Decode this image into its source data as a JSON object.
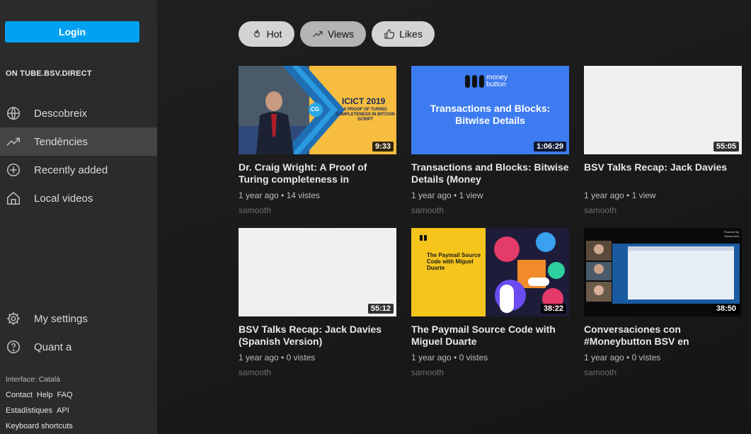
{
  "sidebar": {
    "login_label": "Login",
    "section_title": "ON TUBE.BSV.DIRECT",
    "nav": [
      {
        "label": "Descobreix",
        "icon": "globe-icon"
      },
      {
        "label": "Tendències",
        "icon": "trending-icon"
      },
      {
        "label": "Recently added",
        "icon": "plus-circle-icon"
      },
      {
        "label": "Local videos",
        "icon": "home-icon"
      }
    ],
    "bottom_nav": [
      {
        "label": "My settings",
        "icon": "gear-icon"
      },
      {
        "label": "Quant a",
        "icon": "help-icon"
      }
    ],
    "interface": "Interface: Català",
    "links_row1": [
      "Contact",
      "Help",
      "FAQ"
    ],
    "links_row2": [
      "Estadístiques",
      "API"
    ],
    "links_row3": [
      "Keyboard shortcuts"
    ]
  },
  "filters": [
    {
      "label": "Hot",
      "icon": "flame-icon",
      "active": false
    },
    {
      "label": "Views",
      "icon": "trending-icon",
      "active": true
    },
    {
      "label": "Likes",
      "icon": "thumbs-up-icon",
      "active": false
    }
  ],
  "videos": [
    {
      "title": "Dr. Craig Wright: A Proof of Turing completeness in",
      "duration": "9:33",
      "meta": "1 year ago • 14 vistes",
      "channel": "samooth",
      "thumb_text": [
        "ICICT 2019",
        "A PROOF OF TURING COMPLETENESS IN BITCOIN SCRIPT",
        "CG"
      ]
    },
    {
      "title": "Transactions and Blocks: Bitwise Details (Money",
      "duration": "1:06:29",
      "meta": "1 year ago • 1 view",
      "channel": "samooth",
      "thumb_text": [
        "money",
        "button",
        "Transactions and Blocks:",
        "Bitwise Details"
      ]
    },
    {
      "title": "BSV Talks Recap: Jack Davies",
      "duration": "55:05",
      "meta": "1 year ago • 1 view",
      "channel": "samooth"
    },
    {
      "title": "BSV Talks Recap: Jack Davies (Spanish Version)",
      "duration": "55:12",
      "meta": "1 year ago • 0 vistes",
      "channel": "samooth"
    },
    {
      "title": "The Paymail Source Code with Miguel Duarte",
      "duration": "38:22",
      "meta": "1 year ago • 0 vistes",
      "channel": "samooth",
      "thumb_text": [
        "The Paymail Source",
        "Code with Miguel",
        "Duarte"
      ]
    },
    {
      "title": "Conversaciones con #Moneybutton BSV en",
      "duration": "38:50",
      "meta": "1 year ago • 0 vistes",
      "channel": "samooth",
      "thumb_text": [
        "Powered by",
        "StreamYard"
      ]
    }
  ]
}
